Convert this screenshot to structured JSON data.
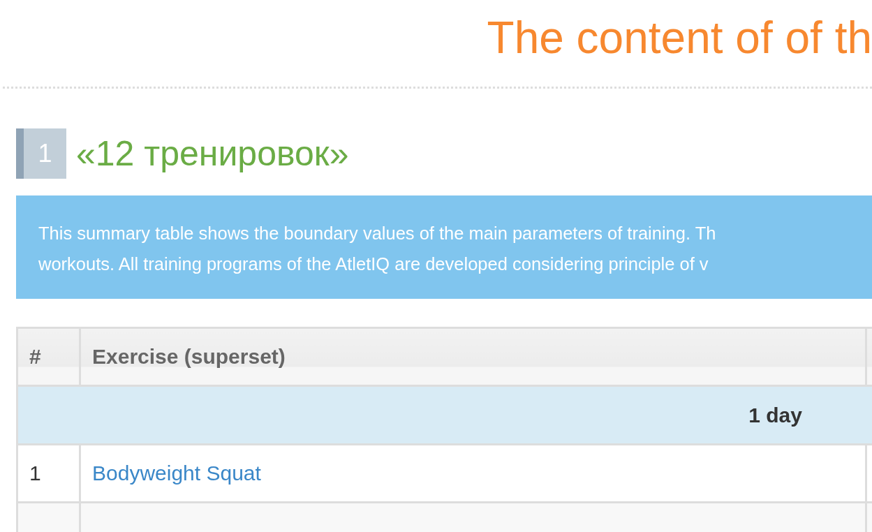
{
  "page_title": "The content of of th",
  "section": {
    "number": "1",
    "title": "«12 тренировок»"
  },
  "info": {
    "lines": [
      "This summary table shows the boundary values of the main parameters of training. Th",
      "workouts. All training programs of the AtletIQ are developed considering principle of v"
    ]
  },
  "table": {
    "columns": [
      "#",
      "Exercise (superset)"
    ],
    "rows": [
      {
        "kind": "group",
        "label": "1 day"
      },
      {
        "kind": "exercise",
        "number": "1",
        "exercise": "Bodyweight Squat"
      },
      {
        "kind": "exercise-hidden"
      }
    ]
  }
}
